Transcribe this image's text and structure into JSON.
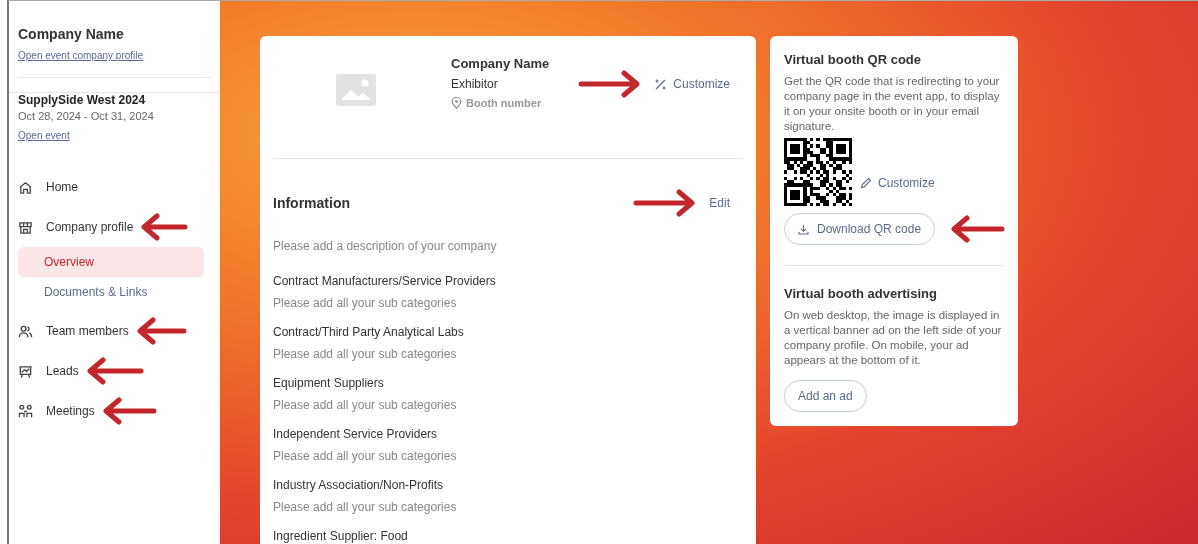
{
  "sidebar": {
    "company": {
      "name": "Company Name",
      "link": "Open event company profile"
    },
    "event": {
      "name": "SupplySide West 2024",
      "dates": "Oct 28, 2024 - Oct 31, 2024",
      "link": "Open event"
    },
    "nav": [
      {
        "kind": "home",
        "label": "Home",
        "selected": false,
        "annotated": false
      },
      {
        "kind": "store",
        "label": "Company profile",
        "selected": false,
        "annotated": true,
        "children": [
          {
            "label": "Overview",
            "selected": true
          },
          {
            "label": "Documents & Links",
            "selected": false
          }
        ]
      },
      {
        "kind": "team",
        "label": "Team members",
        "selected": false,
        "annotated": true
      },
      {
        "kind": "leads",
        "label": "Leads",
        "selected": false,
        "annotated": true
      },
      {
        "kind": "meetings",
        "label": "Meetings",
        "selected": false,
        "annotated": true
      }
    ]
  },
  "profile": {
    "name": "Company Name",
    "type": "Exhibitor",
    "booth": "Booth number",
    "customize": {
      "label": "Customize",
      "annotated": true
    }
  },
  "information": {
    "title": "Information",
    "edit": {
      "label": "Edit",
      "annotated": true
    },
    "description": "Please add a description of your company",
    "categories": [
      {
        "name": "Contract Manufacturers/Service Providers",
        "hint": "Please add all your sub categories"
      },
      {
        "name": "Contract/Third Party Analytical Labs",
        "hint": "Please add all your sub categories"
      },
      {
        "name": "Equipment Suppliers",
        "hint": "Please add all your sub categories"
      },
      {
        "name": "Independent Service Providers",
        "hint": "Please add all your sub categories"
      },
      {
        "name": "Industry Association/Non-Profits",
        "hint": "Please add all your sub categories"
      },
      {
        "name": "Ingredient Supplier: Food"
      }
    ]
  },
  "qr": {
    "title": "Virtual booth QR code",
    "text": "Get the QR code that is redirecting to your company page in the event app, to display it on your onsite booth or in your email signature.",
    "customize": "Customize",
    "download": {
      "label": "Download QR code",
      "annotated": true
    }
  },
  "advertising": {
    "title": "Virtual booth advertising",
    "text": "On web desktop, the image is displayed in a vertical banner ad on the left side of your company profile. On mobile, your ad appears at the bottom of it.",
    "button": "Add an ad"
  }
}
